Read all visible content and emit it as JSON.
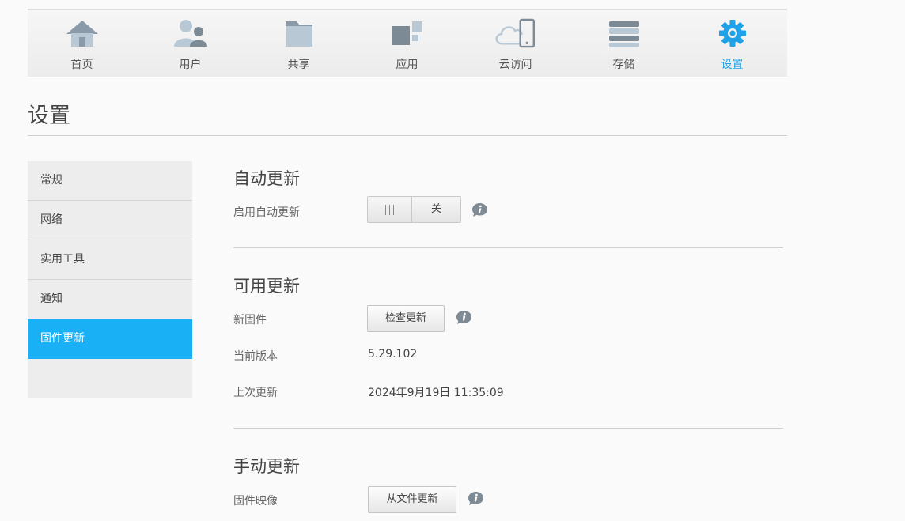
{
  "nav": {
    "items": [
      {
        "label": "首页",
        "icon": "home-icon"
      },
      {
        "label": "用户",
        "icon": "users-icon"
      },
      {
        "label": "共享",
        "icon": "folder-icon"
      },
      {
        "label": "应用",
        "icon": "apps-icon"
      },
      {
        "label": "云访问",
        "icon": "cloud-access-icon"
      },
      {
        "label": "存储",
        "icon": "storage-icon"
      },
      {
        "label": "设置",
        "icon": "gear-icon",
        "active": true
      }
    ],
    "active_color": "#1fa2e8"
  },
  "page": {
    "title": "设置"
  },
  "sidebar": {
    "items": [
      {
        "label": "常规"
      },
      {
        "label": "网络"
      },
      {
        "label": "实用工具"
      },
      {
        "label": "通知"
      },
      {
        "label": "固件更新",
        "active": true
      }
    ],
    "active_color": "#1ab0f5"
  },
  "auto_update": {
    "title": "自动更新",
    "enable_label": "启用自动更新",
    "toggle_state": "关"
  },
  "available_update": {
    "title": "可用更新",
    "firmware_label": "新固件",
    "check_button": "检查更新",
    "current_version_label": "当前版本",
    "current_version": "5.29.102",
    "last_update_label": "上次更新",
    "last_update": "2024年9月19日 11:35:09"
  },
  "manual_update": {
    "title": "手动更新",
    "image_label": "固件映像",
    "file_button": "从文件更新"
  }
}
